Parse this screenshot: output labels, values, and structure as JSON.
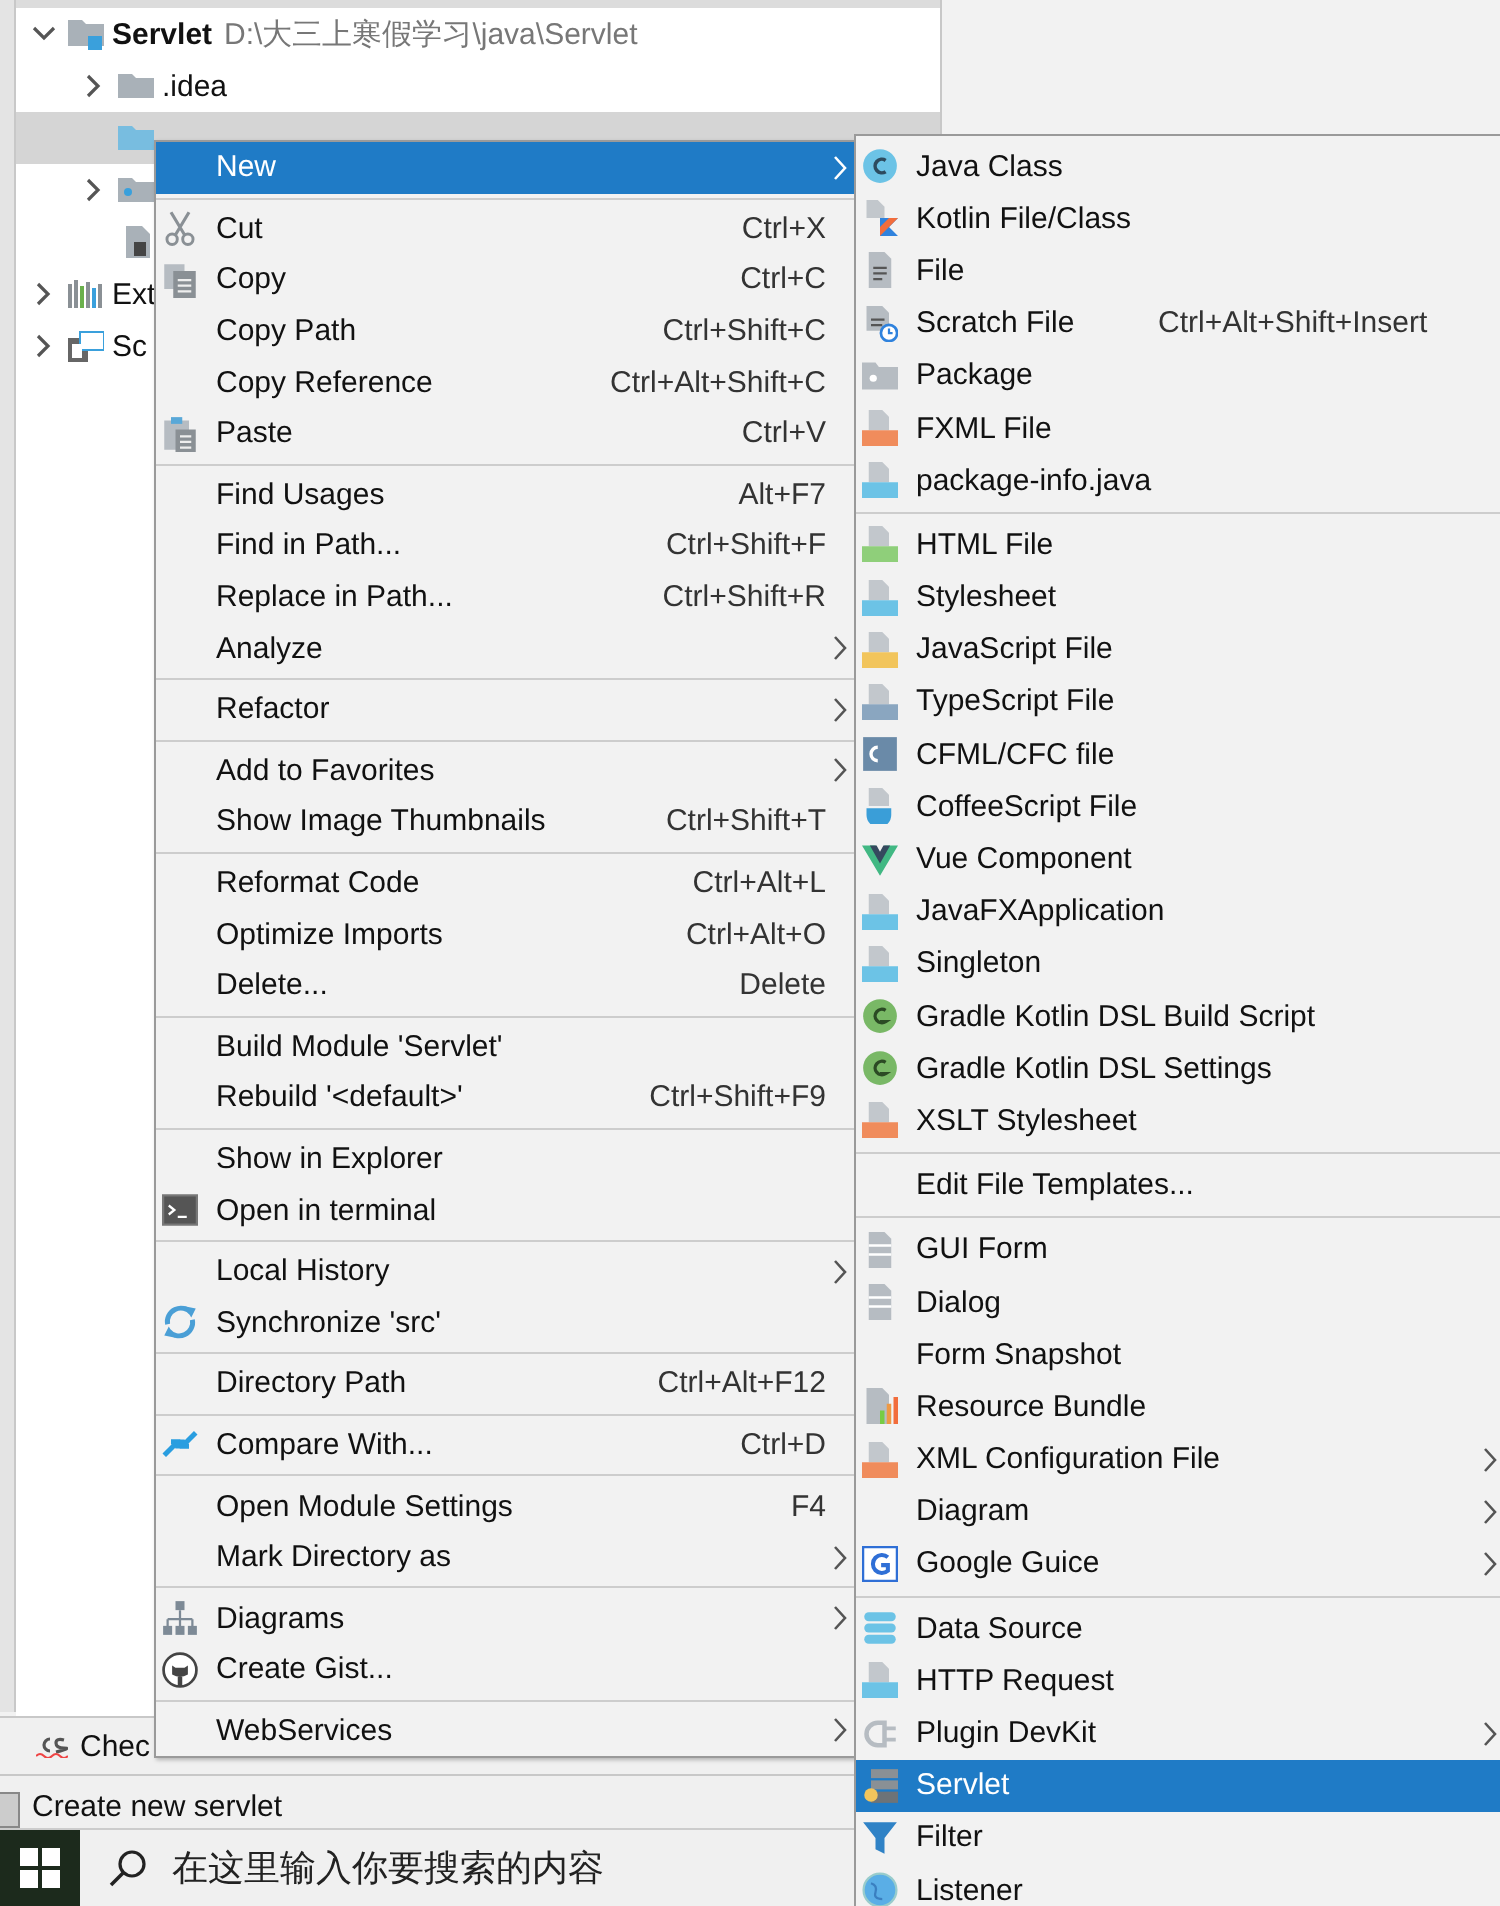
{
  "tree": [
    {
      "label": "Servlet",
      "path": "D:\\大三上寒假学习\\java\\Servlet",
      "kind": "module",
      "expanded": true,
      "selected": false,
      "children": [
        {
          "label": ".idea",
          "kind": "folder",
          "expanded": false,
          "selected": false
        },
        {
          "kind": "source-folder",
          "selected": true
        },
        {
          "kind": "web-folder",
          "expanded": false,
          "selected": false
        },
        {
          "kind": "file",
          "selected": false
        }
      ]
    },
    {
      "label": "Ext",
      "kind": "library",
      "expanded": false,
      "selected": false
    },
    {
      "label": "Sc",
      "kind": "scratches",
      "expanded": false,
      "selected": false
    }
  ],
  "tool_tab": {
    "label": "Chec"
  },
  "status_bar": {
    "text": "Create new servlet"
  },
  "taskbar": {
    "search_placeholder": "在这里输入你要搜索的内容"
  },
  "context_menu": {
    "sections": [
      [
        {
          "label": "New",
          "submenu": true,
          "selected": true
        }
      ],
      [
        {
          "label": "Cut",
          "shortcut": "Ctrl+X",
          "submenu": false,
          "selected": false
        },
        {
          "label": "Copy",
          "shortcut": "Ctrl+C",
          "submenu": false,
          "selected": false
        },
        {
          "label": "Copy Path",
          "shortcut": "Ctrl+Shift+C",
          "submenu": false,
          "selected": false
        },
        {
          "label": "Copy Reference",
          "shortcut": "Ctrl+Alt+Shift+C",
          "submenu": false,
          "selected": false
        },
        {
          "label": "Paste",
          "shortcut": "Ctrl+V",
          "submenu": false,
          "selected": false
        }
      ],
      [
        {
          "label": "Find Usages",
          "shortcut": "Alt+F7",
          "submenu": false,
          "selected": false
        },
        {
          "label": "Find in Path...",
          "shortcut": "Ctrl+Shift+F",
          "submenu": false,
          "selected": false
        },
        {
          "label": "Replace in Path...",
          "shortcut": "Ctrl+Shift+R",
          "submenu": false,
          "selected": false
        },
        {
          "label": "Analyze",
          "submenu": true,
          "selected": false
        }
      ],
      [
        {
          "label": "Refactor",
          "submenu": true,
          "selected": false
        }
      ],
      [
        {
          "label": "Add to Favorites",
          "submenu": true,
          "selected": false
        },
        {
          "label": "Show Image Thumbnails",
          "shortcut": "Ctrl+Shift+T",
          "submenu": false,
          "selected": false
        }
      ],
      [
        {
          "label": "Reformat Code",
          "shortcut": "Ctrl+Alt+L",
          "submenu": false,
          "selected": false
        },
        {
          "label": "Optimize Imports",
          "shortcut": "Ctrl+Alt+O",
          "submenu": false,
          "selected": false
        },
        {
          "label": "Delete...",
          "shortcut": "Delete",
          "submenu": false,
          "selected": false
        }
      ],
      [
        {
          "label": "Build Module 'Servlet'",
          "submenu": false,
          "selected": false
        },
        {
          "label": "Rebuild '<default>'",
          "shortcut": "Ctrl+Shift+F9",
          "submenu": false,
          "selected": false
        }
      ],
      [
        {
          "label": "Show in Explorer",
          "submenu": false,
          "selected": false
        },
        {
          "label": "Open in terminal",
          "submenu": false,
          "selected": false
        }
      ],
      [
        {
          "label": "Local History",
          "submenu": true,
          "selected": false
        },
        {
          "label": "Synchronize 'src'",
          "submenu": false,
          "selected": false
        }
      ],
      [
        {
          "label": "Directory Path",
          "shortcut": "Ctrl+Alt+F12",
          "submenu": false,
          "selected": false
        }
      ],
      [
        {
          "label": "Compare With...",
          "shortcut": "Ctrl+D",
          "submenu": false,
          "selected": false
        }
      ],
      [
        {
          "label": "Open Module Settings",
          "shortcut": "F4",
          "submenu": false,
          "selected": false
        },
        {
          "label": "Mark Directory as",
          "submenu": true,
          "selected": false
        }
      ],
      [
        {
          "label": "Diagrams",
          "submenu": true,
          "selected": false
        },
        {
          "label": "Create Gist...",
          "submenu": false,
          "selected": false
        }
      ],
      [
        {
          "label": "WebServices",
          "submenu": true,
          "selected": false
        }
      ]
    ]
  },
  "new_submenu": {
    "sections": [
      [
        {
          "label": "Java Class",
          "submenu": false,
          "selected": false
        },
        {
          "label": "Kotlin File/Class",
          "submenu": false,
          "selected": false
        },
        {
          "label": "File",
          "submenu": false,
          "selected": false
        },
        {
          "label": "Scratch File",
          "shortcut": "Ctrl+Alt+Shift+Insert",
          "submenu": false,
          "selected": false
        },
        {
          "label": "Package",
          "submenu": false,
          "selected": false
        },
        {
          "label": "FXML File",
          "submenu": false,
          "selected": false
        },
        {
          "label": "package-info.java",
          "submenu": false,
          "selected": false
        }
      ],
      [
        {
          "label": "HTML File",
          "submenu": false,
          "selected": false
        },
        {
          "label": "Stylesheet",
          "submenu": false,
          "selected": false
        },
        {
          "label": "JavaScript File",
          "submenu": false,
          "selected": false
        },
        {
          "label": "TypeScript File",
          "submenu": false,
          "selected": false
        },
        {
          "label": "CFML/CFC file",
          "submenu": false,
          "selected": false
        },
        {
          "label": "CoffeeScript File",
          "submenu": false,
          "selected": false
        },
        {
          "label": "Vue Component",
          "submenu": false,
          "selected": false
        },
        {
          "label": "JavaFXApplication",
          "submenu": false,
          "selected": false
        },
        {
          "label": "Singleton",
          "submenu": false,
          "selected": false
        },
        {
          "label": "Gradle Kotlin DSL Build Script",
          "submenu": false,
          "selected": false
        },
        {
          "label": "Gradle Kotlin DSL Settings",
          "submenu": false,
          "selected": false
        },
        {
          "label": "XSLT Stylesheet",
          "submenu": false,
          "selected": false
        }
      ],
      [
        {
          "label": "Edit File Templates...",
          "submenu": false,
          "selected": false
        }
      ],
      [
        {
          "label": "GUI Form",
          "submenu": false,
          "selected": false
        },
        {
          "label": "Dialog",
          "submenu": false,
          "selected": false
        },
        {
          "label": "Form Snapshot",
          "submenu": false,
          "selected": false
        },
        {
          "label": "Resource Bundle",
          "submenu": false,
          "selected": false
        },
        {
          "label": "XML Configuration File",
          "submenu": true,
          "selected": false
        },
        {
          "label": "Diagram",
          "submenu": true,
          "selected": false
        },
        {
          "label": "Google Guice",
          "submenu": true,
          "selected": false
        }
      ],
      [
        {
          "label": "Data Source",
          "submenu": false,
          "selected": false
        },
        {
          "label": "HTTP Request",
          "submenu": false,
          "selected": false
        },
        {
          "label": "Plugin DevKit",
          "submenu": true,
          "selected": false
        },
        {
          "label": "Servlet",
          "submenu": false,
          "selected": true
        },
        {
          "label": "Filter",
          "submenu": false,
          "selected": false
        },
        {
          "label": "Listener",
          "submenu": false,
          "selected": false
        }
      ]
    ]
  }
}
